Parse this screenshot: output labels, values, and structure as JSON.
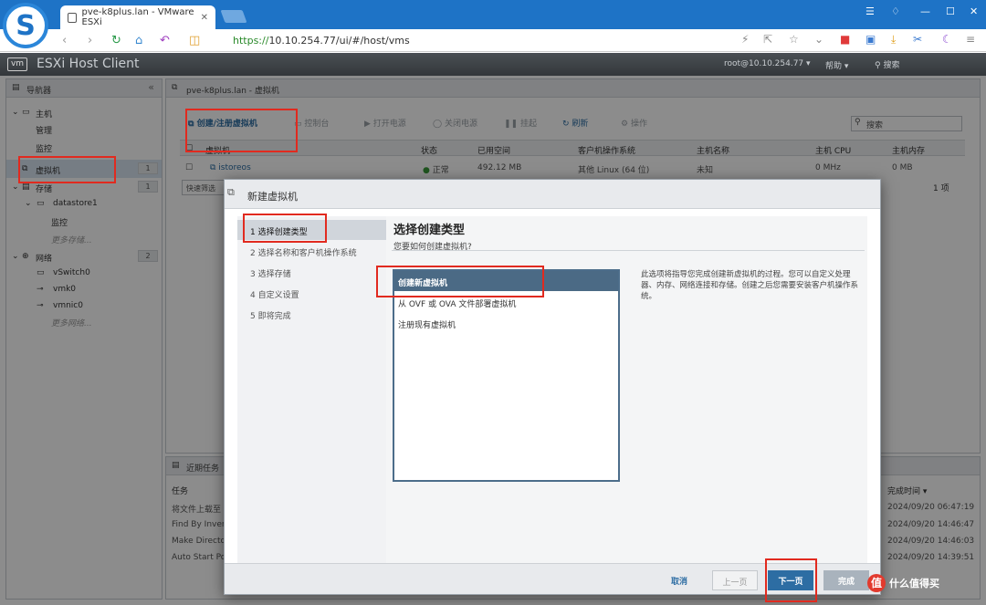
{
  "browser": {
    "tab_title": "pve-k8plus.lan - VMware ESXi",
    "tab_close": "✕",
    "url_scheme": "https://",
    "url_rest": "10.10.254.77/ui/#/host/vms"
  },
  "esxi": {
    "logo": "vm",
    "title": "ESXi Host Client",
    "user": "root@10.10.254.77 ▾",
    "help": "帮助 ▾",
    "search": "搜索"
  },
  "navigator": {
    "header": "导航器",
    "items": [
      {
        "label": "主机",
        "count": ""
      },
      {
        "label": "管理",
        "count": ""
      },
      {
        "label": "监控",
        "count": ""
      },
      {
        "label": "虚拟机",
        "count": "1"
      },
      {
        "label": "存储",
        "count": "1"
      },
      {
        "label": "datastore1",
        "count": ""
      },
      {
        "label": "监控",
        "count": ""
      },
      {
        "label": "更多存储...",
        "count": ""
      },
      {
        "label": "网络",
        "count": "2"
      },
      {
        "label": "vSwitch0",
        "count": ""
      },
      {
        "label": "vmk0",
        "count": ""
      },
      {
        "label": "vmnic0",
        "count": ""
      },
      {
        "label": "更多网络...",
        "count": ""
      }
    ]
  },
  "main": {
    "breadcrumb": "pve-k8plus.lan - 虚拟机",
    "actions": {
      "create": "创建/注册虚拟机",
      "console": "控制台",
      "power_on": "打开电源",
      "power_off": "关闭电源",
      "suspend": "挂起",
      "refresh": "刷新",
      "operate": "操作"
    },
    "search_placeholder": "搜索",
    "columns": [
      "虚拟机",
      "状态",
      "已用空间",
      "客户机操作系统",
      "主机名称",
      "主机 CPU",
      "主机内存"
    ],
    "row": {
      "name": "istoreos",
      "status": "正常",
      "used": "492.12 MB",
      "os": "其他 Linux (64 位)",
      "hostname": "未知",
      "cpu": "0 MHz",
      "mem": "0 MB"
    },
    "filter": "快速筛选",
    "item_count": "1 项"
  },
  "tasks": {
    "header": "近期任务",
    "col_task": "任务",
    "col_done": "完成时间 ▾",
    "rows": [
      {
        "task": "将文件上载至",
        "time": "2024/09/20 06:47:19"
      },
      {
        "task": "Find By Inver",
        "time": "2024/09/20 14:46:47"
      },
      {
        "task": "Make Directo",
        "time": "2024/09/20 14:46:03"
      },
      {
        "task": "Auto Start Po",
        "time": "2024/09/20 14:39:51"
      }
    ]
  },
  "modal": {
    "title": "新建虚拟机",
    "steps": [
      "1  选择创建类型",
      "2  选择名称和客户机操作系统",
      "3  选择存储",
      "4  自定义设置",
      "5  即将完成"
    ],
    "heading": "选择创建类型",
    "subheading": "您要如何创建虚拟机?",
    "options": [
      "创建新虚拟机",
      "从 OVF 或 OVA 文件部署虚拟机",
      "注册现有虚拟机"
    ],
    "description": "此选项将指导您完成创建新虚拟机的过程。您可以自定义处理器、内存、网络连接和存储。创建之后您需要安装客户机操作系统。",
    "buttons": {
      "cancel": "取消",
      "back": "上一页",
      "next": "下一页",
      "finish": "完成"
    }
  },
  "watermark": {
    "badge": "值",
    "text": "什么值得买"
  }
}
